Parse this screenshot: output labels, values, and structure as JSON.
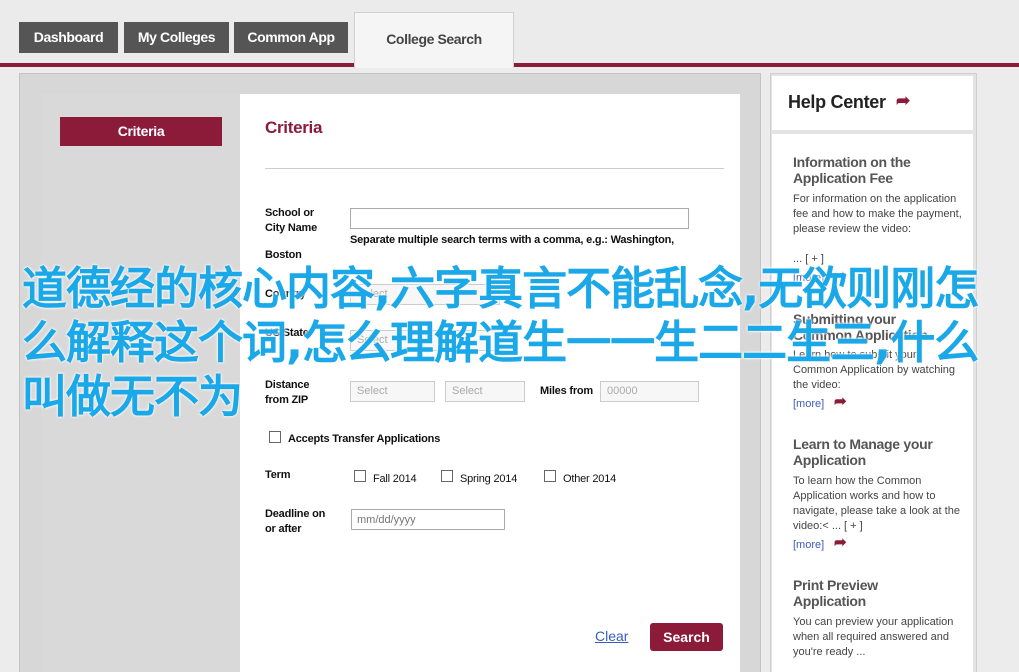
{
  "nav": {
    "tabs": [
      {
        "label": "Dashboard"
      },
      {
        "label": "My Colleges"
      },
      {
        "label": "Common App"
      },
      {
        "label": "College Search"
      }
    ]
  },
  "sidebar": {
    "criteria_label": "Criteria"
  },
  "form": {
    "title": "Criteria",
    "school_label": "School or\nCity Name",
    "school_value": "",
    "school_hint": "Separate multiple search terms with a comma, e.g.: Washington,",
    "school_hint2": "Boston",
    "country_label": "Country",
    "country_value": "Select",
    "state_label": "US State",
    "state_value": "Select",
    "distance_label": "Distance\nfrom ZIP",
    "distance_value": "Select",
    "distance_value2": "Select",
    "miles_label": "Miles from",
    "miles_value": "00000",
    "transfer_label": "Accepts Transfer Applications",
    "term_label": "Term",
    "terms": [
      {
        "label": "Fall 2014"
      },
      {
        "label": "Spring 2014"
      },
      {
        "label": "Other 2014"
      }
    ],
    "deadline_label": "Deadline on\nor after",
    "deadline_placeholder": "mm/dd/yyyy",
    "clear_label": "Clear",
    "search_label": "Search"
  },
  "help": {
    "title": "Help Center",
    "sections": [
      {
        "title": "Information on the Application Fee",
        "text": "For information on the application fee and how to make the payment, please review the video:",
        "expand": "... [ + ]",
        "more": "[more]"
      },
      {
        "title": "Submitting your Common Application",
        "text": "Learn how to submit your Common Application by watching the video:",
        "more": "[more]"
      },
      {
        "title": "Learn to Manage your Application",
        "text": "To learn how the Common Application works and how to navigate, please take a look at the video:< ... [ + ]",
        "more": "[more]"
      },
      {
        "title": "Print Preview Application",
        "text": "You can preview your application when all required answered and you're ready ..."
      }
    ]
  },
  "overlay": {
    "text": "道德经的核心内容,六字真言不能乱念,无欲则刚怎么解释这个词,怎么理解道生一一生二二生三,什么叫做无不为"
  },
  "colors": {
    "brand": "#8c1b3a",
    "tab_bg": "#555555",
    "link": "#3b5bbf",
    "overlay": "#1aa8e8"
  }
}
